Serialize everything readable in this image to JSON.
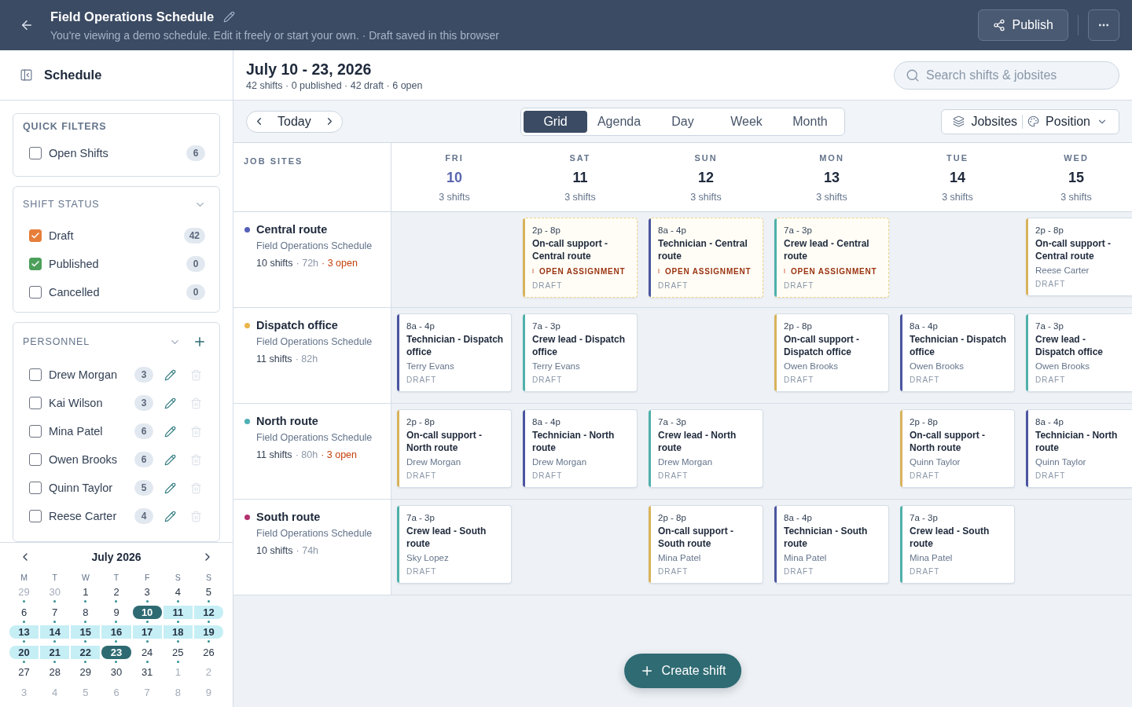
{
  "header": {
    "title": "Field Operations Schedule",
    "subtitle": "You're viewing a demo schedule. Edit it freely or start your own. · Draft saved in this browser",
    "publish": "Publish"
  },
  "sidebar": {
    "title": "Schedule",
    "quick_filters": {
      "title": "QUICK FILTERS",
      "items": [
        {
          "label": "Open Shifts",
          "count": "6",
          "checked": false
        }
      ]
    },
    "shift_status": {
      "title": "SHIFT STATUS",
      "expanded": true,
      "items": [
        {
          "label": "Draft",
          "count": "42",
          "checked": true,
          "color": "#e67e3a"
        },
        {
          "label": "Published",
          "count": "0",
          "checked": true,
          "color": "#4c9f5a"
        },
        {
          "label": "Cancelled",
          "count": "0",
          "checked": false
        }
      ]
    },
    "personnel": {
      "title": "PERSONNEL",
      "expanded": true,
      "items": [
        {
          "label": "Drew Morgan",
          "count": "3",
          "checked": false
        },
        {
          "label": "Kai Wilson",
          "count": "3",
          "checked": false
        },
        {
          "label": "Mina Patel",
          "count": "6",
          "checked": false
        },
        {
          "label": "Owen Brooks",
          "count": "6",
          "checked": false
        },
        {
          "label": "Quinn Taylor",
          "count": "5",
          "checked": false
        },
        {
          "label": "Reese Carter",
          "count": "4",
          "checked": false
        }
      ]
    }
  },
  "calendar": {
    "month": "July 2026",
    "weekdays": [
      "M",
      "T",
      "W",
      "T",
      "F",
      "S",
      "S"
    ],
    "weeks": [
      [
        {
          "label": "29",
          "outside": true,
          "dot": true,
          "in_range": false,
          "selected": false
        },
        {
          "label": "30",
          "outside": true,
          "dot": true,
          "in_range": false,
          "selected": false
        },
        {
          "label": "1",
          "outside": false,
          "dot": true,
          "in_range": false,
          "selected": false
        },
        {
          "label": "2",
          "outside": false,
          "dot": true,
          "in_range": false,
          "selected": false
        },
        {
          "label": "3",
          "outside": false,
          "dot": true,
          "in_range": false,
          "selected": false
        },
        {
          "label": "4",
          "outside": false,
          "dot": true,
          "in_range": false,
          "selected": false
        },
        {
          "label": "5",
          "outside": false,
          "dot": true,
          "in_range": false,
          "selected": false
        }
      ],
      [
        {
          "label": "6",
          "outside": false,
          "dot": true,
          "in_range": false,
          "selected": false
        },
        {
          "label": "7",
          "outside": false,
          "dot": true,
          "in_range": false,
          "selected": false
        },
        {
          "label": "8",
          "outside": false,
          "dot": true,
          "in_range": false,
          "selected": false
        },
        {
          "label": "9",
          "outside": false,
          "dot": true,
          "in_range": false,
          "selected": false
        },
        {
          "label": "10",
          "outside": false,
          "dot": true,
          "in_range": true,
          "selected": true
        },
        {
          "label": "11",
          "outside": false,
          "dot": true,
          "in_range": true,
          "selected": false
        },
        {
          "label": "12",
          "outside": false,
          "dot": true,
          "in_range": true,
          "selected": false
        }
      ],
      [
        {
          "label": "13",
          "outside": false,
          "dot": true,
          "in_range": true,
          "selected": false
        },
        {
          "label": "14",
          "outside": false,
          "dot": true,
          "in_range": true,
          "selected": false
        },
        {
          "label": "15",
          "outside": false,
          "dot": true,
          "in_range": true,
          "selected": false
        },
        {
          "label": "16",
          "outside": false,
          "dot": true,
          "in_range": true,
          "selected": false
        },
        {
          "label": "17",
          "outside": false,
          "dot": true,
          "in_range": true,
          "selected": false
        },
        {
          "label": "18",
          "outside": false,
          "dot": true,
          "in_range": true,
          "selected": false
        },
        {
          "label": "19",
          "outside": false,
          "dot": true,
          "in_range": true,
          "selected": false
        }
      ],
      [
        {
          "label": "20",
          "outside": false,
          "dot": true,
          "in_range": true,
          "selected": false
        },
        {
          "label": "21",
          "outside": false,
          "dot": true,
          "in_range": true,
          "selected": false
        },
        {
          "label": "22",
          "outside": false,
          "dot": true,
          "in_range": true,
          "selected": false
        },
        {
          "label": "23",
          "outside": false,
          "dot": true,
          "in_range": true,
          "selected": true
        },
        {
          "label": "24",
          "outside": false,
          "dot": true,
          "in_range": false,
          "selected": false
        },
        {
          "label": "25",
          "outside": false,
          "dot": true,
          "in_range": false,
          "selected": false
        },
        {
          "label": "26",
          "outside": false,
          "dot": false,
          "in_range": false,
          "selected": false
        }
      ],
      [
        {
          "label": "27",
          "outside": false,
          "dot": false,
          "in_range": false,
          "selected": false
        },
        {
          "label": "28",
          "outside": false,
          "dot": false,
          "in_range": false,
          "selected": false
        },
        {
          "label": "29",
          "outside": false,
          "dot": false,
          "in_range": false,
          "selected": false
        },
        {
          "label": "30",
          "outside": false,
          "dot": false,
          "in_range": false,
          "selected": false
        },
        {
          "label": "31",
          "outside": false,
          "dot": false,
          "in_range": false,
          "selected": false
        },
        {
          "label": "1",
          "outside": true,
          "dot": false,
          "in_range": false,
          "selected": false
        },
        {
          "label": "2",
          "outside": true,
          "dot": false,
          "in_range": false,
          "selected": false
        }
      ],
      [
        {
          "label": "3",
          "outside": true,
          "dot": false,
          "in_range": false,
          "selected": false
        },
        {
          "label": "4",
          "outside": true,
          "dot": false,
          "in_range": false,
          "selected": false
        },
        {
          "label": "5",
          "outside": true,
          "dot": false,
          "in_range": false,
          "selected": false
        },
        {
          "label": "6",
          "outside": true,
          "dot": false,
          "in_range": false,
          "selected": false
        },
        {
          "label": "7",
          "outside": true,
          "dot": false,
          "in_range": false,
          "selected": false
        },
        {
          "label": "8",
          "outside": true,
          "dot": false,
          "in_range": false,
          "selected": false
        },
        {
          "label": "9",
          "outside": true,
          "dot": false,
          "in_range": false,
          "selected": false
        }
      ]
    ]
  },
  "main": {
    "range_title": "July 10 - 23, 2026",
    "summary": "42 shifts · 0 published · 42 draft · 6 open",
    "search": {
      "placeholder": "Search shifts & jobsites"
    },
    "today": "Today",
    "views": [
      {
        "label": "Grid",
        "selected": true
      },
      {
        "label": "Agenda",
        "selected": false
      },
      {
        "label": "Day",
        "selected": false
      },
      {
        "label": "Week",
        "selected": false
      },
      {
        "label": "Month",
        "selected": false
      }
    ],
    "group_by": "Jobsites",
    "color_by": "Position"
  },
  "grid": {
    "corner": "JOB SITES",
    "columns": [
      {
        "weekday": "FRI",
        "date": "10",
        "count": "3 shifts",
        "today": true
      },
      {
        "weekday": "SAT",
        "date": "11",
        "count": "3 shifts",
        "today": false
      },
      {
        "weekday": "SUN",
        "date": "12",
        "count": "3 shifts",
        "today": false
      },
      {
        "weekday": "MON",
        "date": "13",
        "count": "3 shifts",
        "today": false
      },
      {
        "weekday": "TUE",
        "date": "14",
        "count": "3 shifts",
        "today": false
      },
      {
        "weekday": "WED",
        "date": "15",
        "count": "3 shifts",
        "today": false
      }
    ],
    "rows": [
      {
        "name": "Central route",
        "color": "#5560b8",
        "schedule": "Field Operations Schedule",
        "stats": [
          {
            "kind": "total",
            "text": "10 shifts"
          },
          {
            "kind": "hours",
            "text": "· 72h"
          },
          {
            "kind": "open",
            "text": "· 3 open"
          }
        ],
        "cells": [
          {
            "kind": "empty"
          },
          {
            "kind": "shift",
            "time": "2p - 8p",
            "title": "On-call support - Central route",
            "open": true,
            "open_label": "OPEN ASSIGNMENT",
            "status": "DRAFT",
            "color": "#d8b35c"
          },
          {
            "kind": "shift",
            "time": "8a - 4p",
            "title": "Technician - Central route",
            "open": true,
            "open_label": "OPEN ASSIGNMENT",
            "status": "DRAFT",
            "color": "#4b55a0"
          },
          {
            "kind": "shift",
            "time": "7a - 3p",
            "title": "Crew lead - Central route",
            "open": true,
            "open_label": "OPEN ASSIGNMENT",
            "status": "DRAFT",
            "color": "#4fb0aa"
          },
          {
            "kind": "empty"
          },
          {
            "kind": "shift",
            "time": "2p - 8p",
            "title": "On-call support - Central route",
            "open": false,
            "assignee": "Reese Carter",
            "status": "DRAFT",
            "color": "#d8b35c"
          }
        ]
      },
      {
        "name": "Dispatch office",
        "color": "#eab54a",
        "schedule": "Field Operations Schedule",
        "stats": [
          {
            "kind": "total",
            "text": "11 shifts"
          },
          {
            "kind": "hours",
            "text": "· 82h"
          }
        ],
        "cells": [
          {
            "kind": "shift",
            "time": "8a - 4p",
            "title": "Technician - Dispatch office",
            "open": false,
            "assignee": "Terry Evans",
            "status": "DRAFT",
            "color": "#4b55a0"
          },
          {
            "kind": "shift",
            "time": "7a - 3p",
            "title": "Crew lead - Dispatch office",
            "open": false,
            "assignee": "Terry Evans",
            "status": "DRAFT",
            "color": "#4fb0aa"
          },
          {
            "kind": "empty"
          },
          {
            "kind": "shift",
            "time": "2p - 8p",
            "title": "On-call support - Dispatch office",
            "open": false,
            "assignee": "Owen Brooks",
            "status": "DRAFT",
            "color": "#d8b35c"
          },
          {
            "kind": "shift",
            "time": "8a - 4p",
            "title": "Technician - Dispatch office",
            "open": false,
            "assignee": "Owen Brooks",
            "status": "DRAFT",
            "color": "#4b55a0"
          },
          {
            "kind": "shift",
            "time": "7a - 3p",
            "title": "Crew lead - Dispatch office",
            "open": false,
            "assignee": "Owen Brooks",
            "status": "DRAFT",
            "color": "#4fb0aa"
          }
        ]
      },
      {
        "name": "North route",
        "color": "#4db0b5",
        "schedule": "Field Operations Schedule",
        "stats": [
          {
            "kind": "total",
            "text": "11 shifts"
          },
          {
            "kind": "hours",
            "text": "· 80h"
          },
          {
            "kind": "open",
            "text": "· 3 open"
          }
        ],
        "cells": [
          {
            "kind": "shift",
            "time": "2p - 8p",
            "title": "On-call support - North route",
            "open": false,
            "assignee": "Drew Morgan",
            "status": "DRAFT",
            "color": "#d8b35c"
          },
          {
            "kind": "shift",
            "time": "8a - 4p",
            "title": "Technician - North route",
            "open": false,
            "assignee": "Drew Morgan",
            "status": "DRAFT",
            "color": "#4b55a0"
          },
          {
            "kind": "shift",
            "time": "7a - 3p",
            "title": "Crew lead - North route",
            "open": false,
            "assignee": "Drew Morgan",
            "status": "DRAFT",
            "color": "#4fb0aa"
          },
          {
            "kind": "empty"
          },
          {
            "kind": "shift",
            "time": "2p - 8p",
            "title": "On-call support - North route",
            "open": false,
            "assignee": "Quinn Taylor",
            "status": "DRAFT",
            "color": "#d8b35c"
          },
          {
            "kind": "shift",
            "time": "8a - 4p",
            "title": "Technician - North route",
            "open": false,
            "assignee": "Quinn Taylor",
            "status": "DRAFT",
            "color": "#4b55a0"
          }
        ]
      },
      {
        "name": "South route",
        "color": "#b4306e",
        "schedule": "Field Operations Schedule",
        "stats": [
          {
            "kind": "total",
            "text": "10 shifts"
          },
          {
            "kind": "hours",
            "text": "· 74h"
          }
        ],
        "cells": [
          {
            "kind": "shift",
            "time": "7a - 3p",
            "title": "Crew lead - South route",
            "open": false,
            "assignee": "Sky Lopez",
            "status": "DRAFT",
            "color": "#4fb0aa"
          },
          {
            "kind": "empty"
          },
          {
            "kind": "shift",
            "time": "2p - 8p",
            "title": "On-call support - South route",
            "open": false,
            "assignee": "Mina Patel",
            "status": "DRAFT",
            "color": "#d8b35c"
          },
          {
            "kind": "shift",
            "time": "8a - 4p",
            "title": "Technician - South route",
            "open": false,
            "assignee": "Mina Patel",
            "status": "DRAFT",
            "color": "#4b55a0"
          },
          {
            "kind": "shift",
            "time": "7a - 3p",
            "title": "Crew lead - South route",
            "open": false,
            "assignee": "Mina Patel",
            "status": "DRAFT",
            "color": "#4fb0aa"
          },
          {
            "kind": "empty"
          }
        ]
      }
    ]
  },
  "create_button": "Create shift"
}
